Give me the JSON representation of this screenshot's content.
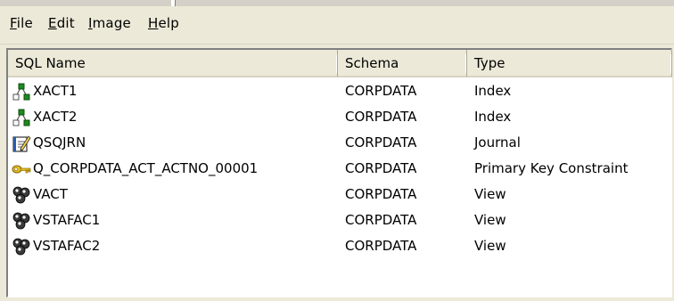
{
  "menubar": {
    "items": [
      {
        "label": "File",
        "accel": "F",
        "rest": "ile"
      },
      {
        "label": "Edit",
        "accel": "E",
        "rest": "dit"
      },
      {
        "label": "Image",
        "accel": "I",
        "rest": "mage"
      },
      {
        "label": "Help",
        "accel": "H",
        "rest": "elp"
      }
    ]
  },
  "table": {
    "columns": [
      "SQL Name",
      "Schema",
      "Type"
    ],
    "rows": [
      {
        "name": "XACT1",
        "schema": "CORPDATA",
        "type": "Index",
        "icon": "index-icon"
      },
      {
        "name": "XACT2",
        "schema": "CORPDATA",
        "type": "Index",
        "icon": "index-icon"
      },
      {
        "name": "QSQJRN",
        "schema": "CORPDATA",
        "type": "Journal",
        "icon": "journal-icon"
      },
      {
        "name": "Q_CORPDATA_ACT_ACTNO_00001",
        "schema": "CORPDATA",
        "type": "Primary Key Constraint",
        "icon": "key-icon"
      },
      {
        "name": "VACT",
        "schema": "CORPDATA",
        "type": "View",
        "icon": "view-icon"
      },
      {
        "name": "VSTAFAC1",
        "schema": "CORPDATA",
        "type": "View",
        "icon": "view-icon"
      },
      {
        "name": "VSTAFAC2",
        "schema": "CORPDATA",
        "type": "View",
        "icon": "view-icon"
      }
    ]
  },
  "colors": {
    "chrome": "#ece9d8",
    "list_background": "#ffffff",
    "index_icon_green": "#1e8a1e",
    "key_icon_gold": "#c8a000",
    "journal_icon_blue": "#2a5cb0"
  }
}
